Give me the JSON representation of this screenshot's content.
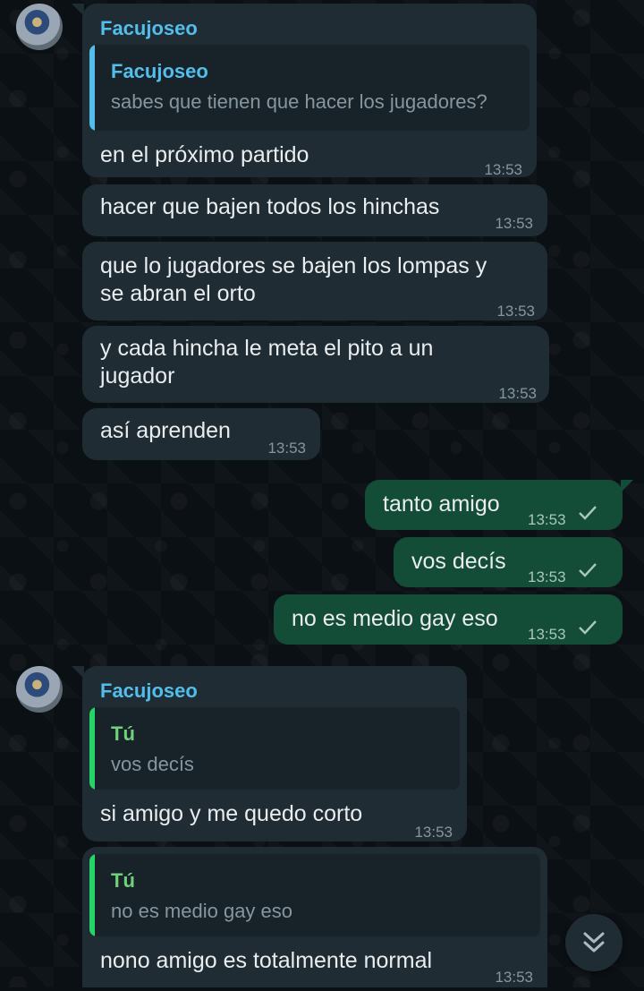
{
  "chat": {
    "group1": {
      "sender": "Facujoseo",
      "quote": {
        "author": "Facujoseo",
        "text": "sabes que tienen que hacer los jugadores?"
      },
      "messages": [
        {
          "text": "en el próximo partido",
          "time": "13:53"
        },
        {
          "text": "hacer que bajen todos los hinchas",
          "time": "13:53"
        },
        {
          "line1": "que lo jugadores se bajen los lompas y",
          "line2": "se abran el orto",
          "time": "13:53"
        },
        {
          "line1": "y cada hincha le meta el pito a un",
          "line2": "jugador",
          "time": "13:53"
        },
        {
          "text": "así aprenden",
          "time": "13:53"
        }
      ]
    },
    "outgoing": [
      {
        "text": "tanto amigo",
        "time": "13:53"
      },
      {
        "text": "vos decís",
        "time": "13:53"
      },
      {
        "text": "no es medio gay eso",
        "time": "13:53"
      }
    ],
    "group2": {
      "sender": "Facujoseo",
      "reply1": {
        "quote": {
          "author": "Tú",
          "text": "vos decís"
        },
        "text": "si amigo y me quedo corto",
        "time": "13:53"
      },
      "reply2": {
        "quote": {
          "author": "Tú",
          "text": "no es medio gay eso"
        },
        "text": "nono amigo es totalmente normal",
        "time": "13:53"
      }
    }
  },
  "colors": {
    "background": "#0b1014",
    "incoming_bubble": "#1f2c33",
    "outgoing_bubble": "#144d37",
    "sender_name": "#53bdeb",
    "quote_bar_other": "#53bdeb",
    "quote_bar_self": "#25d366",
    "quote_author_self": "#6fd27a"
  },
  "icons": {
    "delivered": "single-check-icon",
    "scroll": "double-chevron-down-icon"
  }
}
